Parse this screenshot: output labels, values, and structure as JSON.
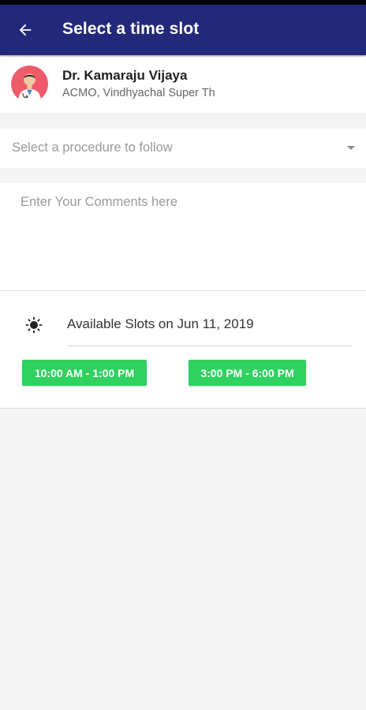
{
  "header": {
    "title": "Select a time slot",
    "back_icon": "arrow-left-icon"
  },
  "doctor": {
    "name": "Dr. Kamaraju Vijaya",
    "designation": "ACMO, Vindhyachal Super Th",
    "avatar_icon": "doctor-avatar-icon"
  },
  "procedure": {
    "placeholder": "Select a procedure to follow",
    "arrow_icon": "dropdown-arrow-icon"
  },
  "comments": {
    "placeholder": "Enter Your Comments here",
    "value": ""
  },
  "slots": {
    "period_icon": "sun-icon",
    "heading": "Available Slots on Jun 11, 2019",
    "items": [
      {
        "label": "10:00 AM - 1:00 PM"
      },
      {
        "label": "3:00 PM - 6:00 PM"
      }
    ]
  },
  "colors": {
    "app_bar": "#23297a",
    "slot_button": "#2fd160",
    "avatar_bg": "#ef5b6b",
    "background": "#f4f4f4"
  }
}
